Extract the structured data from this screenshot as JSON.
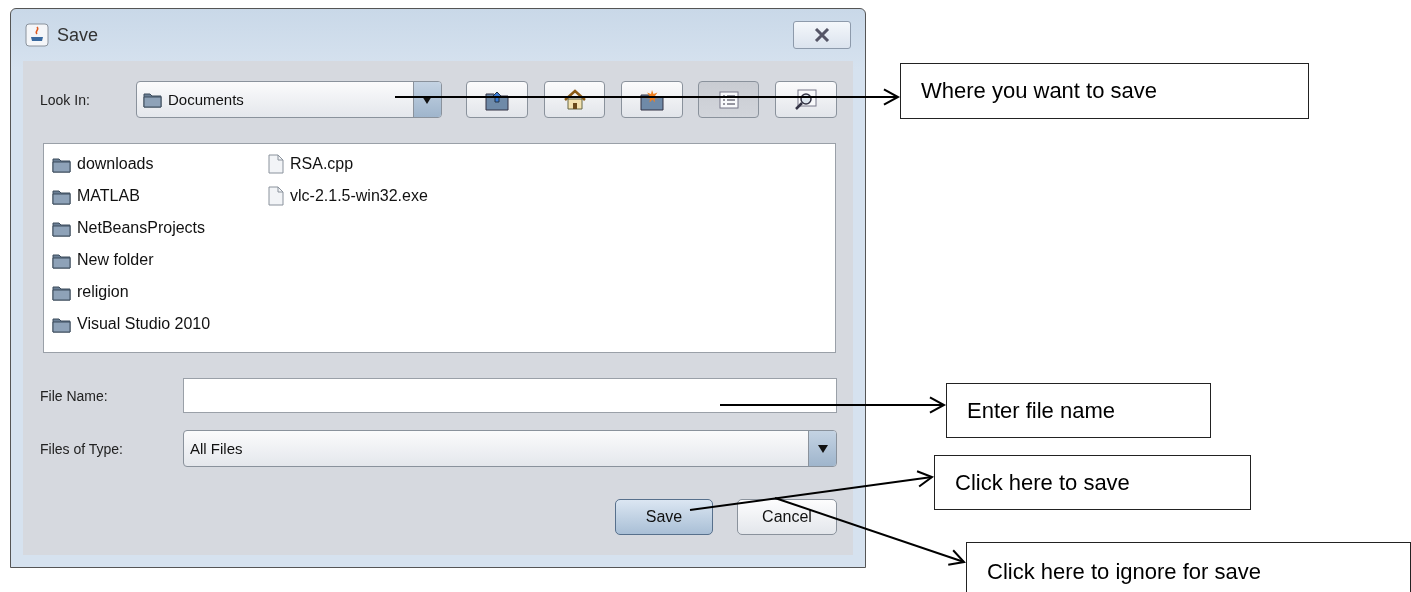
{
  "window": {
    "title": "Save"
  },
  "look_in": {
    "label": "Look In:",
    "value": "Documents"
  },
  "toolbar": [
    {
      "kind": "up",
      "selected": false
    },
    {
      "kind": "home",
      "selected": false
    },
    {
      "kind": "new-folder",
      "selected": false
    },
    {
      "kind": "list",
      "selected": true
    },
    {
      "kind": "details",
      "selected": false
    }
  ],
  "files": [
    {
      "name": "downloads",
      "kind": "folder"
    },
    {
      "name": "MATLAB",
      "kind": "folder"
    },
    {
      "name": "NetBeansProjects",
      "kind": "folder"
    },
    {
      "name": "New folder",
      "kind": "folder"
    },
    {
      "name": "religion",
      "kind": "folder"
    },
    {
      "name": "Visual Studio 2010",
      "kind": "folder"
    },
    {
      "name": "RSA.cpp",
      "kind": "file"
    },
    {
      "name": "vlc-2.1.5-win32.exe",
      "kind": "file"
    }
  ],
  "file_name": {
    "label": "File Name:"
  },
  "files_of_type": {
    "label": "Files of Type:",
    "value": "All Files"
  },
  "buttons": [
    {
      "label": "Save",
      "default": true
    },
    {
      "label": "Cancel",
      "default": false
    }
  ],
  "callouts": [
    {
      "text": "Where you want to save"
    },
    {
      "text": "Enter file name"
    },
    {
      "text": "Click here to save"
    },
    {
      "text": "Click here to ignore for save"
    }
  ]
}
